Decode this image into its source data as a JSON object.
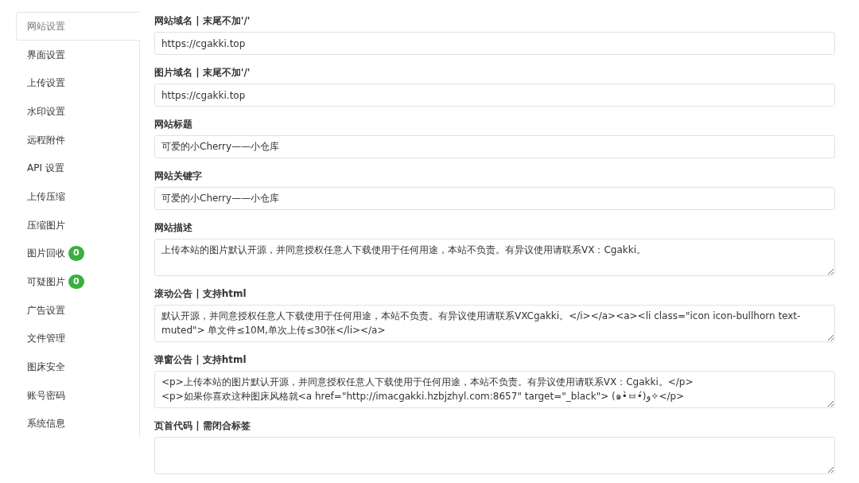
{
  "sidebar": {
    "items": [
      {
        "label": "网站设置",
        "selected": true
      },
      {
        "label": "界面设置",
        "selected": false
      },
      {
        "label": "上传设置",
        "selected": false
      },
      {
        "label": "水印设置",
        "selected": false
      },
      {
        "label": "远程附件",
        "selected": false
      },
      {
        "label": "API 设置",
        "selected": false
      },
      {
        "label": "上传压缩",
        "selected": false
      },
      {
        "label": "压缩图片",
        "selected": false
      },
      {
        "label": "图片回收",
        "selected": false,
        "badge": "0"
      },
      {
        "label": "可疑图片",
        "selected": false,
        "badge": "0"
      },
      {
        "label": "广告设置",
        "selected": false
      },
      {
        "label": "文件管理",
        "selected": false
      },
      {
        "label": "图床安全",
        "selected": false
      },
      {
        "label": "账号密码",
        "selected": false
      },
      {
        "label": "系统信息",
        "selected": false
      }
    ]
  },
  "fields": [
    {
      "label": "网站域名 | 末尾不加'/'",
      "kind": "input",
      "value": "https://cgakki.top"
    },
    {
      "label": "图片域名 | 末尾不加'/'",
      "kind": "input",
      "value": "https://cgakki.top"
    },
    {
      "label": "网站标题",
      "kind": "input",
      "value": "可爱的小Cherry——小仓库"
    },
    {
      "label": "网站关键字",
      "kind": "input",
      "value": "可爱的小Cherry——小仓库"
    },
    {
      "label": "网站描述",
      "kind": "textarea",
      "value": "上传本站的图片默认开源，并同意授权任意人下载使用于任何用途，本站不负责。有异议使用请联系VX：Cgakki。"
    },
    {
      "label": "滚动公告 | 支持html",
      "kind": "textarea",
      "value": "默认开源，并同意授权任意人下载使用于任何用途，本站不负责。有异议使用请联系VXCgakki。</i></a><a><li class=\"icon icon-bullhorn text-muted\"> 单文件≤10M,单次上传≤30张</li></a>"
    },
    {
      "label": "弹窗公告 | 支持html",
      "kind": "textarea",
      "value": "<p>上传本站的图片默认开源，并同意授权任意人下载使用于任何用途，本站不负责。有异议使用请联系VX：Cgakki。</p>\n<p>如果你喜欢这种图床风格就<a href=\"http://imacgakki.hzbjzhyl.com:8657\" target=\"_black\"> (๑•̀ㅂ•́)و✧</p>"
    },
    {
      "label": "页首代码 | 需闭合标签",
      "kind": "textarea"
    }
  ]
}
